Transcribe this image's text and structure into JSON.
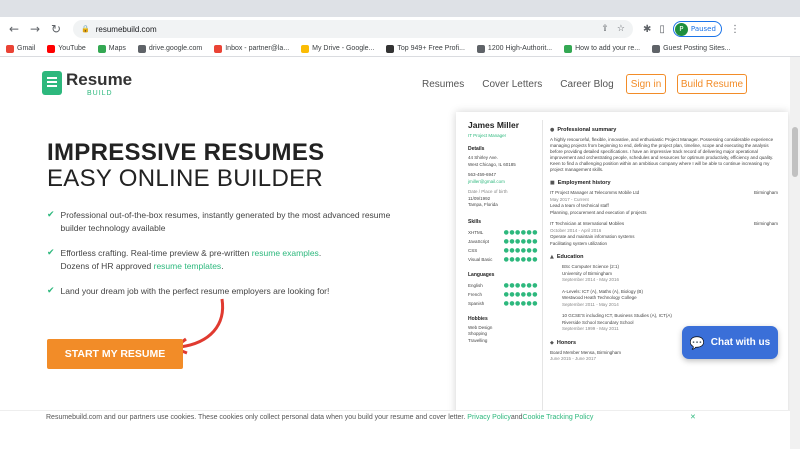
{
  "browser": {
    "url": "resumebuild.com",
    "profile_label": "Paused",
    "profile_initial": "P",
    "bookmarks": [
      {
        "label": "Gmail",
        "color": "#ea4335"
      },
      {
        "label": "YouTube",
        "color": "#ff0000"
      },
      {
        "label": "Maps",
        "color": "#34a853"
      },
      {
        "label": "drive.google.com",
        "color": "#5f6368"
      },
      {
        "label": "Inbox - partner@la...",
        "color": "#ea4335"
      },
      {
        "label": "My Drive - Google...",
        "color": "#fbbc04"
      },
      {
        "label": "Top 949+ Free Profi...",
        "color": "#333333"
      },
      {
        "label": "1200 High-Authorit...",
        "color": "#5f6368"
      },
      {
        "label": "How to add your re...",
        "color": "#34a853"
      },
      {
        "label": "Guest Posting Sites...",
        "color": "#5f6368"
      }
    ]
  },
  "header": {
    "logo_text": "Resume",
    "logo_sub": "BUILD",
    "nav": [
      "Resumes",
      "Cover Letters",
      "Career Blog"
    ],
    "sign_in": "Sign in",
    "build_resume": "Build Resume"
  },
  "hero": {
    "title_line1": "IMPRESSIVE RESUMES",
    "title_line2": "EASY ONLINE BUILDER",
    "feature1": "Professional out-of-the-box resumes, instantly generated by the most advanced resume builder technology available",
    "feature2_a": "Effortless crafting. Real-time preview & pre-written ",
    "feature2_link1": "resume examples",
    "feature2_b": ".",
    "feature2_c": "Dozens of HR approved ",
    "feature2_link2": "resume templates",
    "feature2_d": ".",
    "feature3": "Land your dream job with the perfect resume employers are looking for!",
    "cta": "START MY RESUME"
  },
  "resume_preview": {
    "name": "James Miller",
    "job_title": "IT Project Manager",
    "details_h": "Details",
    "address1": "44 Shirley Ave.",
    "address2": "West Chicago, IL 60185",
    "phone": "563-459-6947",
    "email": "jmiller@gmail.com",
    "dob_label": "Date / Place of birth",
    "dob": "11/09/1992",
    "pob": "Tampa, Florida",
    "skills_h": "Skills",
    "skills": [
      "XHTML",
      "JavaScript",
      "CSS",
      "Visual Basic"
    ],
    "languages_h": "Languages",
    "languages": [
      "English",
      "French",
      "Spanish"
    ],
    "hobbies_h": "Hobbies",
    "hobbies": [
      "Web Design",
      "Shopping",
      "Travelling"
    ],
    "summary_h": "Professional summary",
    "summary": "A highly resourceful, flexible, innovative, and enthusiastic Project Manager. Possessing considerable experience managing projects from beginning to end, defining the project plan, timeline, scope and executing the analysis before providing detailed specifications. I have an impressive track record of delivering major operational improvement and orchestrating people, schedules and resources for optimum productivity, efficiency and quality. Keen to find a challenging position within an ambitious company where I will be able to continue increasing my project management skills.",
    "employment_h": "Employment history",
    "job1_title": "IT Project Manager at Telecomms Mobile Ltd",
    "job1_loc": "Birmingham",
    "job1_dates": "May 2017 - Current",
    "job1_b1": "Lead a team of technical staff",
    "job1_b2": "Planning, procurement and execution of projects",
    "job2_title": "IT Technician at International Mobiles",
    "job2_loc": "Birmingham",
    "job2_dates": "October 2014 - April 2016",
    "job2_b1": "Operate and maintain information systems",
    "job2_b2": "Facilitating system utilization",
    "education_h": "Education",
    "edu1_title": "BSc Computer Science (2:1)",
    "edu1_school": "University of Birmingham",
    "edu1_dates": "September 2014 - May 2016",
    "edu2_title": "A-Levels: ICT (A), Maths (A), Biology (B)",
    "edu2_school": "Westwood Heath Technology College",
    "edu2_dates": "September 2011 - May 2014",
    "edu3_title": "10 GCSE'S including ICT, Business Studies (A), ICT(A)",
    "edu3_school": "Riverside School Secondary School",
    "edu3_dates": "September 1999 - May 2011",
    "honors_h": "Honors",
    "honor1": "Board Member Mensa, Birmingham",
    "honor1_dates": "June 2015 - June 2017"
  },
  "chat": {
    "label": "Chat with us"
  },
  "cookie": {
    "text": "Resumebuild.com and our partners use cookies. These cookies only collect personal data when you build your resume and cover letter. ",
    "privacy": "Privacy Policy",
    "and": " and ",
    "tracking": "Cookie Tracking Policy",
    "close": "✕"
  }
}
